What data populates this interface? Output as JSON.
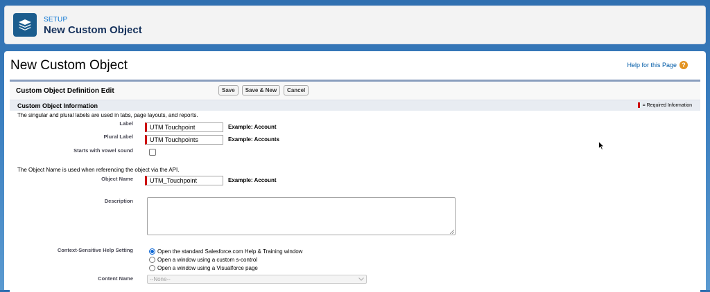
{
  "setup_header": {
    "kicker": "SETUP",
    "title": "New Custom Object",
    "icon": "layers-icon"
  },
  "page": {
    "title": "New Custom Object",
    "help_link": "Help for this Page",
    "help_icon": "?"
  },
  "block": {
    "title": "Custom Object Definition Edit",
    "buttons": {
      "save": "Save",
      "save_new": "Save & New",
      "cancel": "Cancel"
    }
  },
  "section": {
    "title": "Custom Object Information",
    "required_legend": "= Required Information"
  },
  "form": {
    "intro_labels": "The singular and plural labels are used in tabs, page layouts, and reports.",
    "label": {
      "label": "Label",
      "value": "UTM Touchpoint",
      "example": "Example:  Account"
    },
    "plural_label": {
      "label": "Plural Label",
      "value": "UTM Touchpoints",
      "example": "Example:  Accounts"
    },
    "vowel": {
      "label": "Starts with vowel sound",
      "checked": false
    },
    "intro_api": "The Object Name is used when referencing the object via the API.",
    "object_name": {
      "label": "Object Name",
      "value": "UTM_Touchpoint",
      "example": "Example:  Account"
    },
    "description": {
      "label": "Description",
      "value": ""
    },
    "help_setting": {
      "label": "Context-Sensitive Help Setting",
      "options": [
        "Open the standard Salesforce.com Help & Training window",
        "Open a window using a custom s-control",
        "Open a window using a Visualforce page"
      ],
      "selected_index": 0
    },
    "content_name": {
      "label": "Content Name",
      "value": "--None--"
    }
  },
  "colors": {
    "required": "#cc0000",
    "brand": "#1b5d8e",
    "link": "#015ba7",
    "header_rule": "#8a9ebe"
  }
}
